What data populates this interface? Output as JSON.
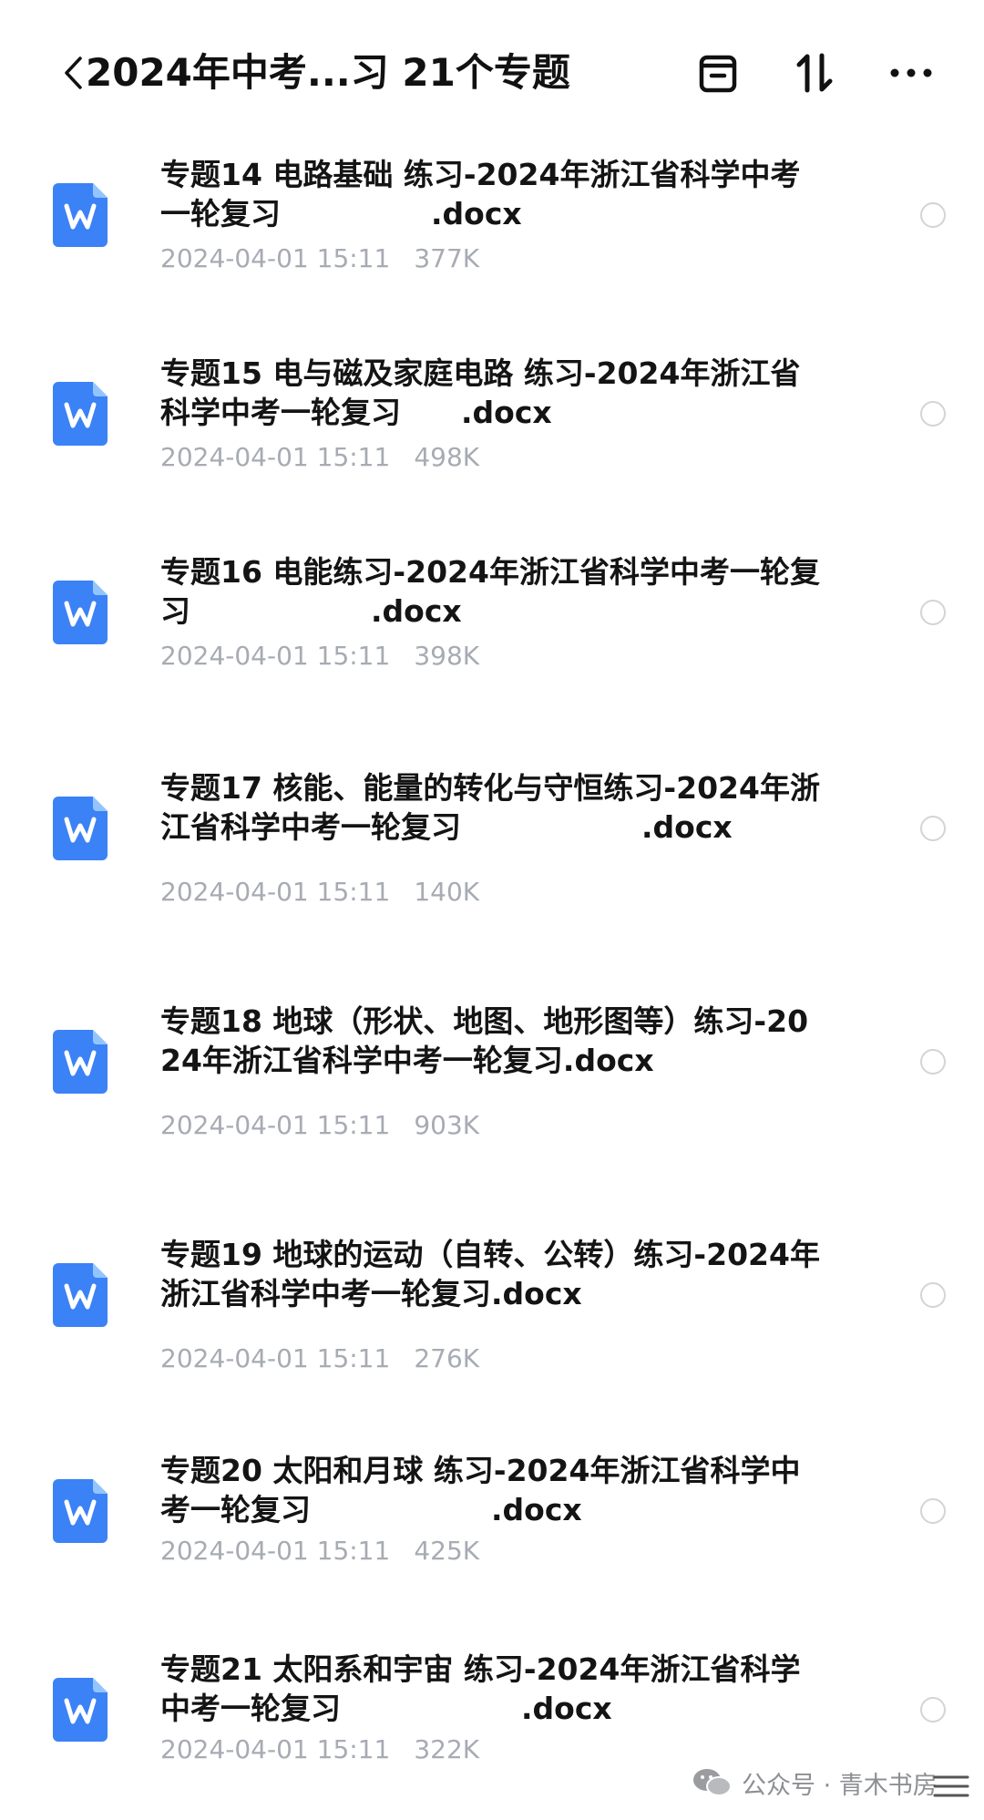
{
  "header": {
    "title": "2024年中考...习 21个专题",
    "actions": {
      "archive_icon": "archive-box-icon",
      "sort_icon": "sort-arrows-icon",
      "more_icon": "more-dots-icon"
    }
  },
  "colors": {
    "word_icon": "#3b82f6",
    "meta_text": "#a7abb3",
    "radio_border": "#d2d4d8"
  },
  "files": [
    {
      "name": "专题14 电路基础 练习-2024年浙江省科学中考一轮复习　　　　　.docx",
      "date": "2024-04-01 15:11",
      "size": "377K"
    },
    {
      "name": "专题15 电与磁及家庭电路 练习-2024年浙江省科学中考一轮复习　　.docx",
      "date": "2024-04-01 15:11",
      "size": "498K"
    },
    {
      "name": "专题16 电能练习-2024年浙江省科学中考一轮复习　　　　　　.docx",
      "date": "2024-04-01 15:11",
      "size": "398K"
    },
    {
      "name": "专题17 核能、能量的转化与守恒练习-2024年浙江省科学中考一轮复习　　　　　　.docx",
      "date": "2024-04-01 15:11",
      "size": "140K"
    },
    {
      "name": "专题18 地球（形状、地图、地形图等）练习-2024年浙江省科学中考一轮复习.docx",
      "date": "2024-04-01 15:11",
      "size": "903K"
    },
    {
      "name": "专题19 地球的运动（自转、公转）练习-2024年浙江省科学中考一轮复习.docx",
      "date": "2024-04-01 15:11",
      "size": "276K"
    },
    {
      "name": "专题20 太阳和月球 练习-2024年浙江省科学中考一轮复习　　　　　　.docx",
      "date": "2024-04-01 15:11",
      "size": "425K"
    },
    {
      "name": "专题21 太阳系和宇宙 练习-2024年浙江省科学中考一轮复习　　　　　　.docx",
      "date": "2024-04-01 15:11",
      "size": "322K"
    }
  ],
  "watermark": {
    "text": "公众号 · 青木书房"
  }
}
